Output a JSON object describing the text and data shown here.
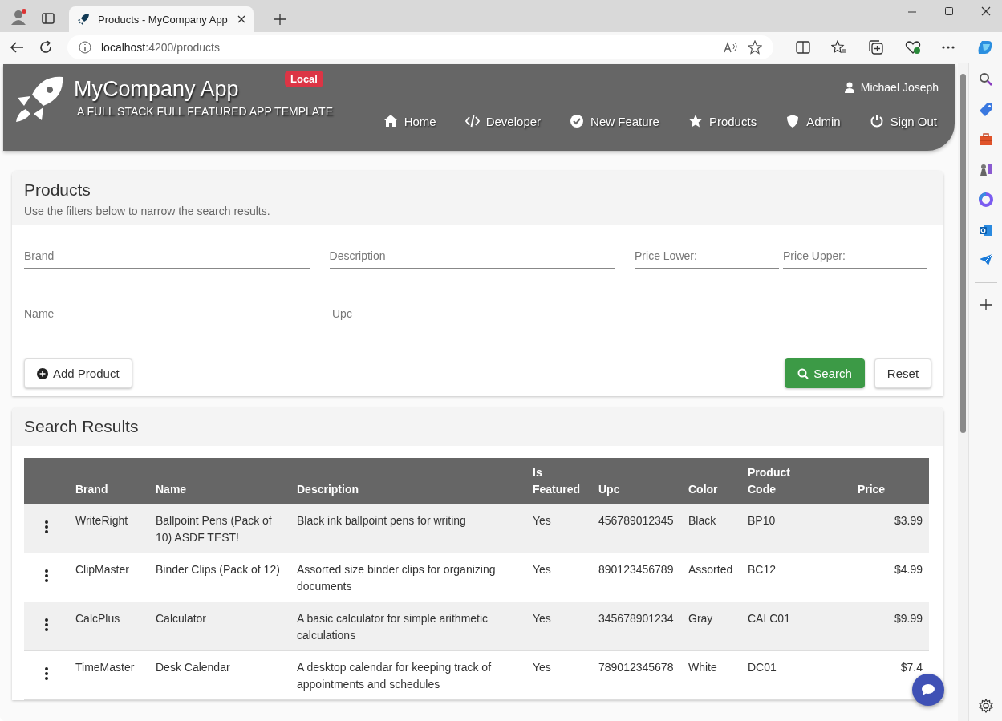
{
  "browser": {
    "tab_title": "Products - MyCompany App",
    "url_host": "localhost",
    "url_path": ":4200/products"
  },
  "header": {
    "title": "MyCompany App",
    "subtitle": "A FULL STACK FULL FEATURED APP TEMPLATE",
    "badge": "Local",
    "user": "Michael Joseph",
    "nav": [
      {
        "label": "Home"
      },
      {
        "label": "Developer"
      },
      {
        "label": "New Feature"
      },
      {
        "label": "Products"
      },
      {
        "label": "Admin"
      },
      {
        "label": "Sign Out"
      }
    ]
  },
  "filters": {
    "title": "Products",
    "hint": "Use the filters below to narrow the search results.",
    "rows": [
      [
        {
          "placeholder": "Brand"
        },
        {
          "placeholder": "Description"
        },
        {
          "placeholder": "Price Lower:"
        },
        {
          "placeholder": "Price Upper:"
        }
      ],
      [
        {
          "placeholder": "Name"
        },
        {
          "placeholder": "Upc"
        }
      ]
    ],
    "add_button": "Add Product",
    "search_button": "Search",
    "reset_button": "Reset"
  },
  "results": {
    "title": "Search Results",
    "columns": [
      "Brand",
      "Name",
      "Description",
      "Is Featured",
      "Upc",
      "Color",
      "Product Code",
      "Price"
    ],
    "rows": [
      [
        "WriteRight",
        "Ballpoint Pens (Pack of 10) ASDF TEST!",
        "Black ink ballpoint pens for writing",
        "Yes",
        "456789012345",
        "Black",
        "BP10",
        "$3.99"
      ],
      [
        "ClipMaster",
        "Binder Clips (Pack of 12)",
        "Assorted size binder clips for organizing documents",
        "Yes",
        "890123456789",
        "Assorted",
        "BC12",
        "$4.99"
      ],
      [
        "CalcPlus",
        "Calculator",
        "A basic calculator for simple arithmetic calculations",
        "Yes",
        "345678901234",
        "Gray",
        "CALC01",
        "$9.99"
      ],
      [
        "TimeMaster",
        "Desk Calendar",
        "A desktop calendar for keeping track of appointments and schedules",
        "Yes",
        "789012345678",
        "White",
        "DC01",
        "$7.4"
      ]
    ]
  }
}
